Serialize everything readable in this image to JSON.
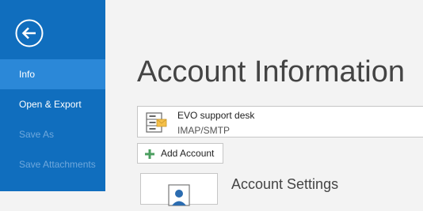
{
  "sidebar": {
    "back_icon": "back-arrow-icon",
    "items": [
      {
        "label": "Info",
        "selected": true,
        "enabled": true
      },
      {
        "label": "Open & Export",
        "selected": false,
        "enabled": true
      },
      {
        "label": "Save As",
        "selected": false,
        "enabled": false
      },
      {
        "label": "Save Attachments",
        "selected": false,
        "enabled": false
      }
    ]
  },
  "main": {
    "title": "Account Information",
    "account": {
      "name": "EVO support desk",
      "type": "IMAP/SMTP",
      "icon": "account-server-icon"
    },
    "add_account": {
      "label": "Add Account",
      "icon": "plus-icon"
    },
    "account_settings": {
      "label": "Account Settings",
      "icon": "account-settings-icon"
    }
  },
  "colors": {
    "sidebar_bg": "#106ebe",
    "sidebar_selected": "#2b88d8",
    "sidebar_disabled_text": "#6fa8dc",
    "page_bg": "#f3f3f3",
    "title_text": "#444444",
    "plus_icon": "#4b9e5f"
  }
}
